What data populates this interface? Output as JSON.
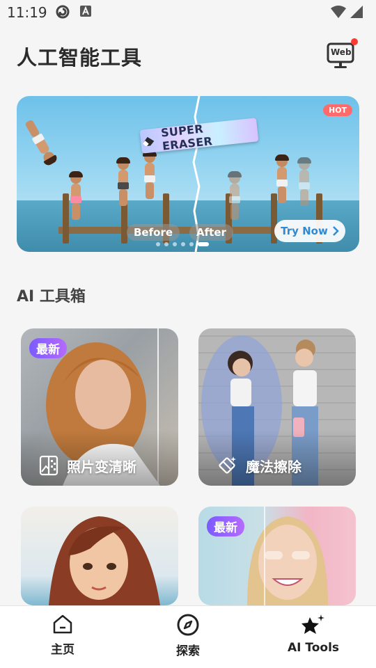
{
  "status_bar": {
    "time": "11:19"
  },
  "header": {
    "title": "人工智能工具",
    "web_button_label": "Web"
  },
  "banner": {
    "headline": "SUPER ERASER",
    "hot_badge": "HOT",
    "before_label": "Before",
    "after_label": "After",
    "cta_label": "Try Now",
    "slide_count": 6,
    "active_slide": 6
  },
  "section": {
    "title": "AI 工具箱"
  },
  "tools": [
    {
      "badge": "最新",
      "label": "照片变清晰",
      "icon": "photo-enhance-icon"
    },
    {
      "badge": "",
      "label": "魔法擦除",
      "icon": "magic-eraser-icon"
    },
    {
      "badge": "",
      "label": "",
      "icon": ""
    },
    {
      "badge": "最新",
      "label": "",
      "icon": ""
    }
  ],
  "bottom_nav": {
    "items": [
      {
        "label": "主页",
        "icon": "home-icon"
      },
      {
        "label": "探索",
        "icon": "compass-icon"
      },
      {
        "label": "AI Tools",
        "icon": "sparkle-star-icon"
      }
    ],
    "active": "AI Tools"
  },
  "colors": {
    "accent_blue": "#2c8ad6",
    "badge_purple": "#7b5bff",
    "hot_red": "#ff6b6b",
    "notification_dot": "#ff3b30"
  }
}
